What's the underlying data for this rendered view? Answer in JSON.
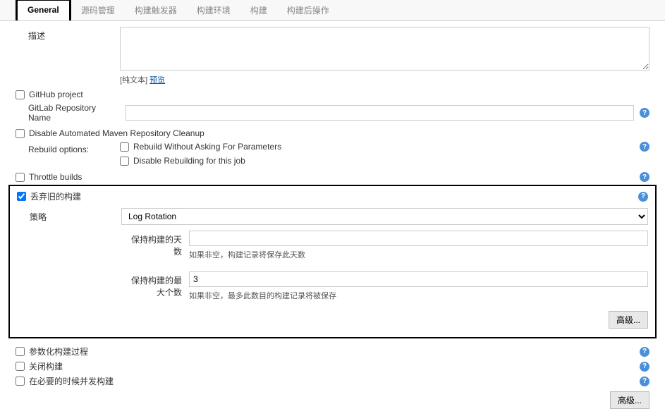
{
  "tabs": {
    "general": "General",
    "scm": "源码管理",
    "triggers": "构建触发器",
    "env": "构建环境",
    "build": "构建",
    "postbuild": "构建后操作"
  },
  "description": {
    "label": "描述",
    "value": "",
    "plaintext_prefix": "[纯文本] ",
    "preview_link": "预览"
  },
  "github_project": {
    "label": "GitHub project"
  },
  "gitlab": {
    "label": "GitLab Repository Name",
    "value": ""
  },
  "disable_cleanup": {
    "label": "Disable Automated Maven Repository Cleanup"
  },
  "rebuild": {
    "label": "Rebuild options:",
    "opt1": "Rebuild Without Asking For Parameters",
    "opt2": "Disable Rebuilding for this job"
  },
  "throttle": {
    "label": "Throttle builds"
  },
  "discard": {
    "label": "丢弃旧的构建",
    "strategy_label": "策略",
    "strategy_value": "Log Rotation",
    "days_label": "保持构建的天数",
    "days_value": "",
    "days_hint": "如果非空，构建记录将保存此天数",
    "max_label": "保持构建的最大个数",
    "max_value": "3",
    "max_hint": "如果非空，最多此数目的构建记录将被保存",
    "advanced": "高级..."
  },
  "param_build": {
    "label": "参数化构建过程"
  },
  "disable_build": {
    "label": "关闭构建"
  },
  "concurrent": {
    "label": "在必要的时候并发构建"
  },
  "bottom_advanced": "高级..."
}
